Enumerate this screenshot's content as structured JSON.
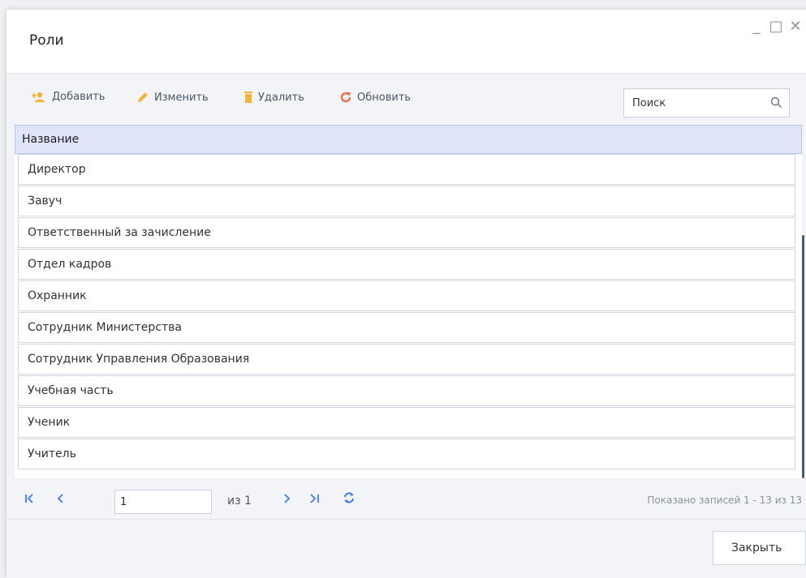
{
  "window": {
    "title": "Роли"
  },
  "toolbar": {
    "add_label": "Добавить",
    "edit_label": "Изменить",
    "delete_label": "Удалить",
    "refresh_label": "Обновить"
  },
  "search": {
    "placeholder": "Поиск"
  },
  "grid": {
    "column_header": "Название",
    "rows": [
      "Директор",
      "Завуч",
      "Ответственный за зачисление",
      "Отдел кадров",
      "Охранник",
      "Сотрудник Министерства",
      "Сотрудник Управления Образования",
      "Учебная часть",
      "Ученик",
      "Учитель"
    ]
  },
  "pager": {
    "page_value": "1",
    "of_text": "из 1",
    "info": "Показано записей 1 - 13 из 13"
  },
  "footer": {
    "close_label": "Закрыть"
  },
  "colors": {
    "accent": "#3f7be0",
    "add_icon": "#f2b23b",
    "edit_icon": "#f2b23b",
    "delete_icon": "#f2b23b",
    "refresh_icon": "#ee6a47",
    "header_bg": "#dfe6fb"
  }
}
